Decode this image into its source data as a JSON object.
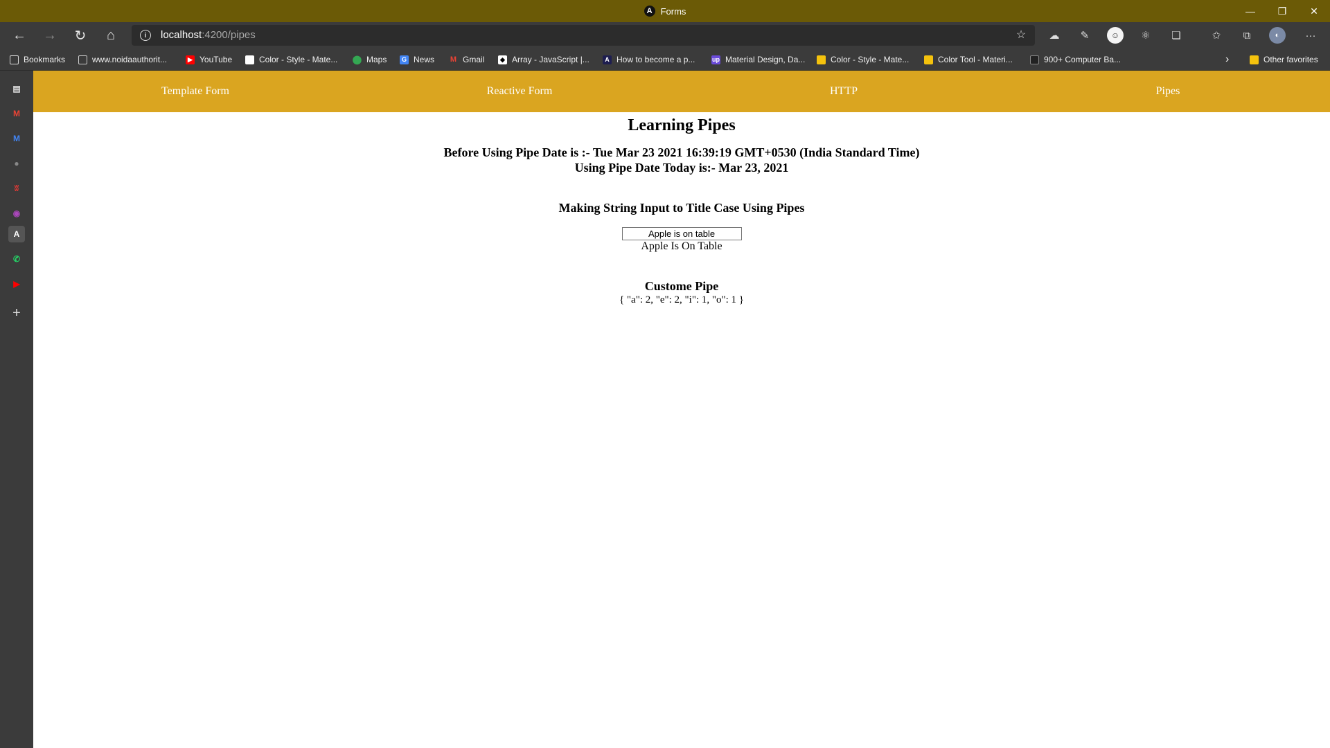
{
  "window": {
    "title": "Forms",
    "app_logo_glyph": "A",
    "controls": {
      "minimize": "—",
      "restore": "❐",
      "close": "✕"
    }
  },
  "toolbar": {
    "url_host": "localhost",
    "url_rest": ":4200/pipes",
    "back_icon": "←",
    "forward_icon": "→",
    "reload_icon": "↻",
    "home_icon": "⌂",
    "info_icon": "i",
    "favorite_add_icon": "☆",
    "more_icon": "···"
  },
  "bookmarks": {
    "items": [
      {
        "label": "Bookmarks",
        "icon_color": "#dddddd"
      },
      {
        "label": "www.noidaauthorit...",
        "icon_color": "#cccccc"
      },
      {
        "label": "YouTube",
        "icon_color": "#ff0000"
      },
      {
        "label": "Color - Style - Mate...",
        "icon_color": "#ffffff"
      },
      {
        "label": "Maps",
        "icon_color": "#34a853"
      },
      {
        "label": "News",
        "icon_color": "#4285f4"
      },
      {
        "label": "Gmail",
        "icon_color": "#ea4335"
      },
      {
        "label": "Array - JavaScript |...",
        "icon_color": "#ffffff"
      },
      {
        "label": "How to become a p...",
        "icon_color": "#1e1e50"
      },
      {
        "label": "Material Design, Da...",
        "icon_color": "#6b4bdb"
      },
      {
        "label": "Color - Style - Mate...",
        "icon_color": "#f4c20d"
      },
      {
        "label": "Color Tool - Materi...",
        "icon_color": "#f4c20d"
      },
      {
        "label": "900+ Computer Ba...",
        "icon_color": "#222222"
      }
    ],
    "overflow_icon": "›",
    "other_favorites": "Other favorites"
  },
  "sidebar": {
    "items": [
      {
        "name": "collections-icon",
        "glyph": "▤",
        "color": "#dddddd"
      },
      {
        "name": "gmail-icon",
        "glyph": "M",
        "color": "#ea4335"
      },
      {
        "name": "gmail-alt-icon",
        "glyph": "M",
        "color": "#4285f4"
      },
      {
        "name": "github-icon",
        "glyph": "●",
        "color": "#888888"
      },
      {
        "name": "app-red-icon",
        "glyph": "ʬ",
        "color": "#e53935"
      },
      {
        "name": "app-colorful-icon",
        "glyph": "◉",
        "color": "#ab47bc"
      },
      {
        "name": "angular-icon",
        "glyph": "A",
        "color": "#ffffff"
      },
      {
        "name": "whatsapp-icon",
        "glyph": "✆",
        "color": "#25d366"
      },
      {
        "name": "youtube-icon",
        "glyph": "▶",
        "color": "#ff0000"
      }
    ],
    "add_icon": "+"
  },
  "app": {
    "nav": {
      "template_form": "Template Form",
      "reactive_form": "Reactive Form",
      "http": "HTTP",
      "pipes": "Pipes"
    },
    "heading": "Learning Pipes",
    "before_pipe_date": "Before Using Pipe Date is :- Tue Mar 23 2021 16:39:19 GMT+0530 (India Standard Time)",
    "using_pipe_date": "Using Pipe Date Today is:- Mar 23, 2021",
    "title_case_heading": "Making String Input to Title Case Using Pipes",
    "title_case_input_value": "Apple is on table",
    "title_case_output": "Apple Is On Table",
    "custom_pipe_heading": "Custome Pipe",
    "custom_pipe_output": "{ \"a\": 2, \"e\": 2, \"i\": 1, \"o\": 1 }"
  },
  "colors": {
    "title_bar": "#6b5a06",
    "nav_bar": "#daa520",
    "browser_chrome": "#3b3b3b"
  }
}
